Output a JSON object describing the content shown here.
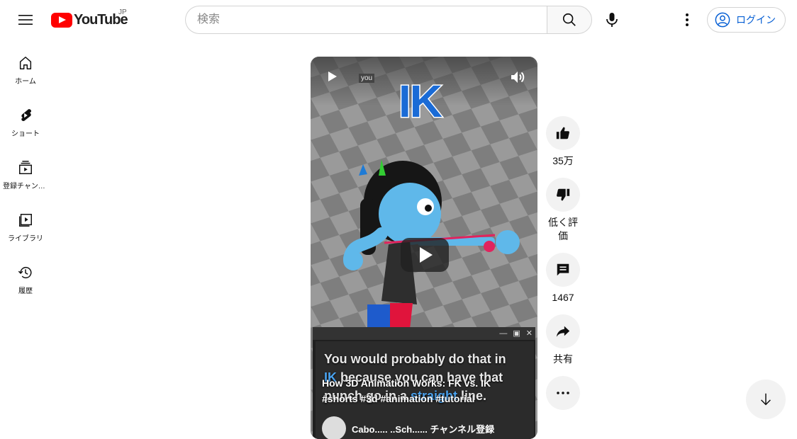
{
  "header": {
    "logo_text": "YouTube",
    "region": "JP",
    "search_placeholder": "検索",
    "login_label": "ログイン"
  },
  "sidebar": {
    "items": [
      {
        "label": "ホーム",
        "icon": "home-icon"
      },
      {
        "label": "ショート",
        "icon": "shorts-icon"
      },
      {
        "label": "登録チャンネル",
        "icon": "subscriptions-icon"
      },
      {
        "label": "ライブラリ",
        "icon": "library-icon"
      },
      {
        "label": "履歴",
        "icon": "history-icon"
      }
    ]
  },
  "video": {
    "overlay_tag": "you",
    "ik_text": "IK",
    "caption_line1": "You would probably do that in",
    "caption_ik": "IK",
    "caption_line2": " because you can have that",
    "caption_line3": "punch go in a ",
    "caption_straight": "straight",
    "caption_line4": " line.",
    "title": "How 3D Animation Works: FK vs. IK #shorts #3d #animation #tutorial",
    "channel_text": "Cabo..... ..Sch......       チャンネル登録"
  },
  "actions": {
    "like_count": "35万",
    "dislike_label": "低く評価",
    "comment_count": "1467",
    "share_label": "共有"
  },
  "colors": {
    "brand_red": "#ff0000",
    "link_blue": "#065fd4",
    "button_bg": "#f2f2f2"
  }
}
